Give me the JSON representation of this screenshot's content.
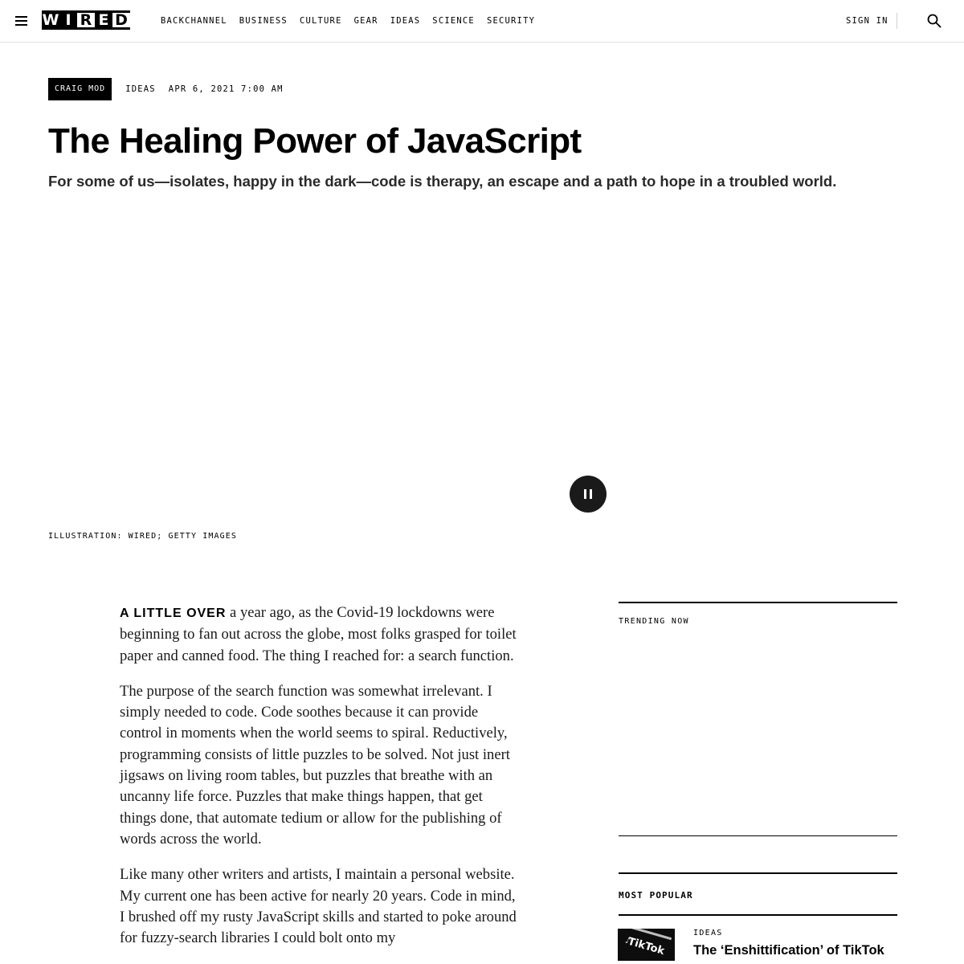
{
  "header": {
    "logo_letters": [
      "W",
      "I",
      "R",
      "E",
      "D"
    ],
    "nav": [
      "BACKCHANNEL",
      "BUSINESS",
      "CULTURE",
      "GEAR",
      "IDEAS",
      "SCIENCE",
      "SECURITY"
    ],
    "sign_in": "SIGN IN",
    "icons": {
      "menu": "hamburger-menu-icon",
      "search": "search-icon"
    }
  },
  "article": {
    "byline": "CRAIG MOD",
    "rubric": "IDEAS",
    "date": "APR 6, 2021 7:00 AM",
    "title": "The Healing Power of JavaScript",
    "dek": "For some of us—isolates, happy in the dark—code is therapy, an escape and a path to hope in a troubled world.",
    "media_control": "pause-icon",
    "caption": "ILLUSTRATION: WIRED; GETTY IMAGES",
    "lead_in": "A LITTLE OVER",
    "paragraphs": [
      " a year ago, as the Covid-19 lockdowns were beginning to fan out across the globe, most folks grasped for toilet paper and canned food. The thing I reached for: a search function.",
      "The purpose of the search function was somewhat irrelevant. I simply needed to code. Code soothes because it can provide control in moments when the world seems to spiral. Reductively, programming consists of little puzzles to be solved. Not just inert jigsaws on living room tables, but puzzles that breathe with an uncanny life force. Puzzles that make things happen, that get things done, that automate tedium or allow for the publishing of words across the world.",
      "Like many other writers and artists, I maintain a personal website. My current one has been active for nearly 20 years. Code in mind, I brushed off my rusty JavaScript skills and started to poke around for fuzzy-search libraries I could bolt onto my"
    ]
  },
  "sidebar": {
    "trending_label": "TRENDING NOW",
    "popular_label": "MOST POPULAR",
    "popular_items": [
      {
        "rubric": "IDEAS",
        "title": "The ‘Enshittification’ of TikTok",
        "thumb_text": "TikTok"
      }
    ]
  }
}
